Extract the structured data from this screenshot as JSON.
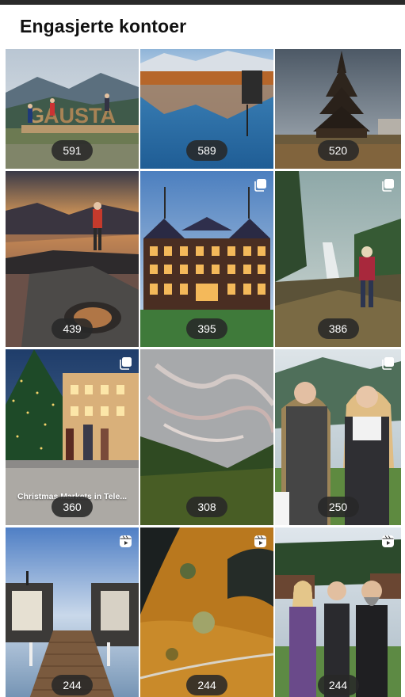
{
  "header": {
    "title": "Engasjerte kontoer"
  },
  "tiles": [
    {
      "count": "591",
      "scene": "gausta-sign",
      "badge": "",
      "caption": ""
    },
    {
      "count": "589",
      "scene": "lake-reflection",
      "badge": "",
      "caption": ""
    },
    {
      "count": "520",
      "scene": "stave-church",
      "badge": "",
      "caption": ""
    },
    {
      "count": "439",
      "scene": "fjord-sunset",
      "badge": "",
      "caption": ""
    },
    {
      "count": "395",
      "scene": "historic-hotel",
      "badge": "carousel-icon",
      "caption": ""
    },
    {
      "count": "386",
      "scene": "waterfall-child",
      "badge": "carousel-icon",
      "caption": ""
    },
    {
      "count": "360",
      "scene": "christmas-market",
      "badge": "carousel-icon",
      "caption": "Christmas Markets in Tele..."
    },
    {
      "count": "308",
      "scene": "rock-formation",
      "badge": "",
      "caption": ""
    },
    {
      "count": "250",
      "scene": "two-women",
      "badge": "carousel-icon",
      "caption": ""
    },
    {
      "count": "244",
      "scene": "sauna-pier",
      "badge": "reels-icon",
      "caption": ""
    },
    {
      "count": "244",
      "scene": "aerial-marsh",
      "badge": "reels-icon",
      "caption": ""
    },
    {
      "count": "244",
      "scene": "three-people",
      "badge": "reels-icon",
      "caption": ""
    }
  ]
}
